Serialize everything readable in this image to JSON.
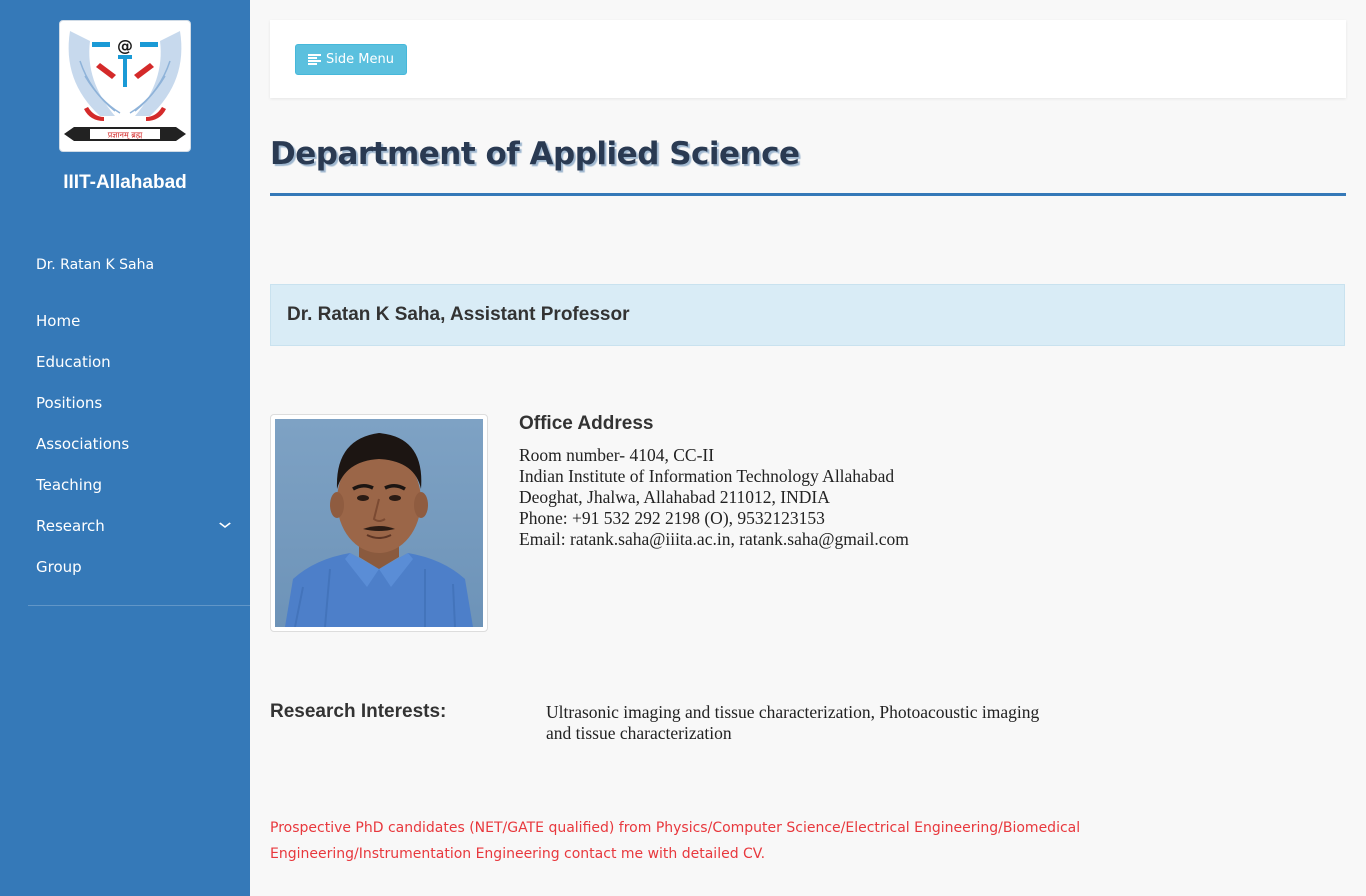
{
  "sidebar": {
    "brand": "IIIT-Allahabad",
    "logo_motto": "प्रज्ञानम् ब्रह्म",
    "professor": "Dr. Ratan K Saha",
    "items": [
      {
        "label": "Home",
        "has_submenu": false
      },
      {
        "label": "Education",
        "has_submenu": false
      },
      {
        "label": "Positions",
        "has_submenu": false
      },
      {
        "label": "Associations",
        "has_submenu": false
      },
      {
        "label": "Teaching",
        "has_submenu": false
      },
      {
        "label": "Research",
        "has_submenu": true,
        "chevron_icon": "chevron-down-icon"
      },
      {
        "label": "Group",
        "has_submenu": false
      }
    ],
    "background": "#3579b8"
  },
  "topbar": {
    "side_menu_label": "Side Menu",
    "side_menu_icon": "align-left-icon"
  },
  "page": {
    "title": "Department of Applied Science",
    "heading": "Dr. Ratan K Saha, Assistant Professor",
    "office_heading": "Office Address",
    "address_lines": [
      "Room number- 4104, CC-II",
      "Indian Institute of Information Technology Allahabad",
      "Deoghat, Jhalwa, Allahabad 211012, INDIA",
      "Phone: +91 532 292 2198 (O), 9532123153",
      "Email: ratank.saha@iiita.ac.in, ratank.saha@gmail.com"
    ],
    "research_label": "Research Interests:",
    "research_text": "Ultrasonic imaging and tissue characterization, Photoacoustic imaging and tissue characterization",
    "phd_note": "Prospective PhD candidates (NET/GATE qualified) from Physics/Computer Science/Electrical Engineering/Biomedical Engineering/Instrumentation Engineering contact me with detailed CV."
  },
  "colors": {
    "accent": "#3579b8",
    "button": "#5bc0de",
    "panel": "#d9ecf6",
    "note": "#e8383d"
  }
}
